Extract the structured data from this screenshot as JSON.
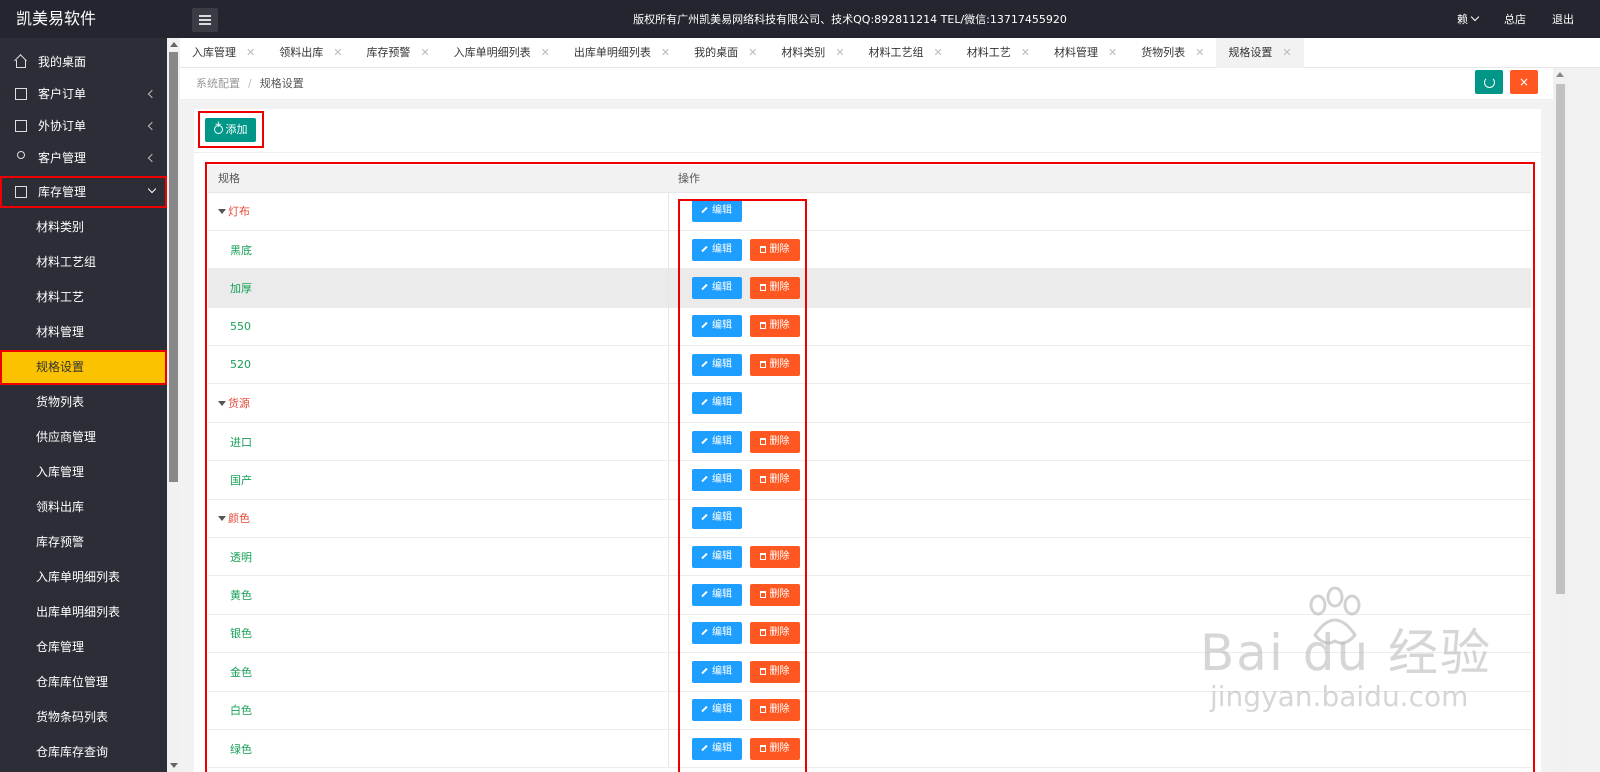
{
  "header": {
    "logo": "凯美易软件",
    "copyright": "版权所有广州凯美易网络科技有限公司、技术QQ:892811214 TEL/微信:13717455920",
    "user": "赖",
    "store": "总店",
    "logout": "退出"
  },
  "sidebar": {
    "items": [
      {
        "label": "我的桌面",
        "icon": "home-icon"
      },
      {
        "label": "客户订单",
        "icon": "order-icon"
      },
      {
        "label": "外协订单",
        "icon": "outsource-icon"
      },
      {
        "label": "客户管理",
        "icon": "user-icon"
      },
      {
        "label": "库存管理",
        "icon": "box-icon"
      }
    ],
    "sub_items": [
      "材料类别",
      "材料工艺组",
      "材料工艺",
      "材料管理",
      "规格设置",
      "货物列表",
      "供应商管理",
      "入库管理",
      "领料出库",
      "库存预警",
      "入库单明细列表",
      "出库单明细列表",
      "仓库管理",
      "仓库库位管理",
      "货物条码列表",
      "仓库库存查询"
    ]
  },
  "tabs": [
    "入库管理",
    "领料出库",
    "库存预警",
    "入库单明细列表",
    "出库单明细列表",
    "我的桌面",
    "材料类别",
    "材料工艺组",
    "材料工艺",
    "材料管理",
    "货物列表",
    "规格设置"
  ],
  "breadcrumb": {
    "parent": "系统配置",
    "separator": "/",
    "current": "规格设置"
  },
  "toolbar": {
    "add_label": "添加",
    "close_label": "×"
  },
  "table": {
    "headers": [
      "规格",
      "操作"
    ],
    "edit_label": "编辑",
    "delete_label": "删除",
    "rows": [
      {
        "name": "灯布",
        "type": "parent"
      },
      {
        "name": "黑底",
        "type": "child"
      },
      {
        "name": "加厚",
        "type": "child",
        "hover": true
      },
      {
        "name": "550",
        "type": "child"
      },
      {
        "name": "520",
        "type": "child"
      },
      {
        "name": "货源",
        "type": "parent"
      },
      {
        "name": "进口",
        "type": "child"
      },
      {
        "name": "国产",
        "type": "child"
      },
      {
        "name": "颜色",
        "type": "parent"
      },
      {
        "name": "透明",
        "type": "child"
      },
      {
        "name": "黄色",
        "type": "child"
      },
      {
        "name": "银色",
        "type": "child"
      },
      {
        "name": "金色",
        "type": "child"
      },
      {
        "name": "白色",
        "type": "child"
      },
      {
        "name": "绿色",
        "type": "child"
      }
    ]
  },
  "watermark": {
    "title": "Bai du 经验",
    "url": "jingyan.baidu.com"
  },
  "colors": {
    "teal": "#009688",
    "blue": "#1e9fff",
    "orange": "#ff5722",
    "active_yellow": "#fbc200",
    "parent_red": "#e54b3a",
    "child_green": "#18a058"
  }
}
